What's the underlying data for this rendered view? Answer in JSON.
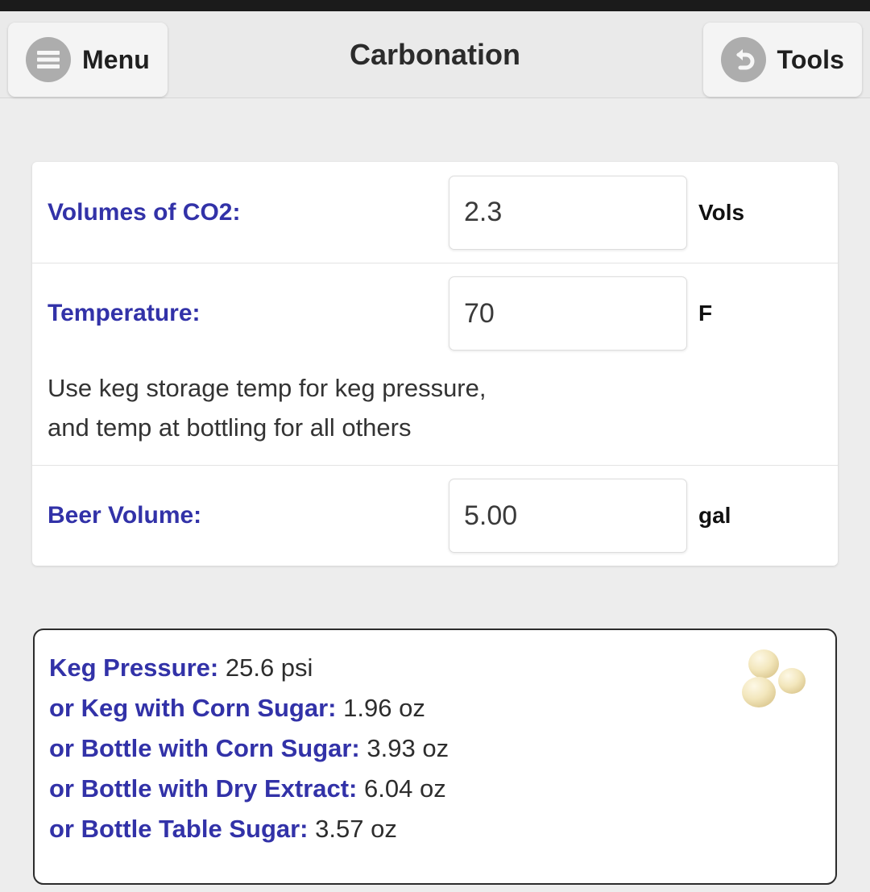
{
  "header": {
    "title": "Carbonation",
    "menu_label": "Menu",
    "tools_label": "Tools",
    "menu_icon": "hamburger-menu-icon",
    "tools_icon": "undo-arrow-icon"
  },
  "form": {
    "fields": [
      {
        "label": "Volumes of CO2:",
        "value": "2.3",
        "unit": "Vols"
      },
      {
        "label": "Temperature:",
        "value": "70",
        "unit": "F"
      },
      {
        "label": "Beer Volume:",
        "value": "5.00",
        "unit": "gal"
      }
    ],
    "helper_text": "Use keg storage temp for keg pressure,\nand temp at bottling for all others"
  },
  "results": {
    "lines": [
      {
        "label": "Keg Pressure:",
        "value": "25.6 psi"
      },
      {
        "label": "or Keg with Corn Sugar:",
        "value": "1.96 oz"
      },
      {
        "label": "or Bottle with Corn Sugar:",
        "value": "3.93 oz"
      },
      {
        "label": "or Bottle with Dry Extract:",
        "value": "6.04 oz"
      },
      {
        "label": "or Bottle Table Sugar:",
        "value": "3.57 oz"
      }
    ],
    "decoration_icon": "sugar-grains-icon"
  },
  "colors": {
    "label_blue": "#3232a8",
    "page_background": "#ededed",
    "header_background": "#eaeaea",
    "status_strip": "#1b1b1b",
    "panel_border": "#2c2c2c",
    "sugar_grain": "#f0e3b8"
  }
}
